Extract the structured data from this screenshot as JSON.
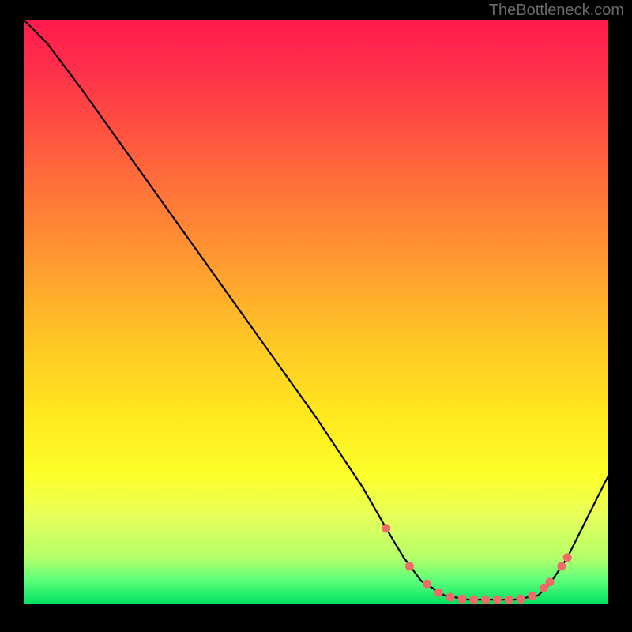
{
  "watermark": "TheBottleneck.com",
  "chart_data": {
    "type": "line",
    "title": "",
    "xlabel": "",
    "ylabel": "",
    "xlim": [
      0,
      100
    ],
    "ylim": [
      0,
      100
    ],
    "curve": {
      "x": [
        0,
        4,
        10,
        20,
        30,
        40,
        50,
        58,
        62,
        65,
        68,
        72,
        76,
        80,
        84,
        88,
        90,
        93,
        100
      ],
      "y": [
        100,
        96,
        88,
        74,
        60,
        46,
        32,
        20,
        13,
        8,
        4,
        1.5,
        0.8,
        0.8,
        0.8,
        1.5,
        3.5,
        8,
        22
      ]
    },
    "markers": {
      "x": [
        62,
        66,
        69,
        71,
        73,
        75,
        77,
        79,
        81,
        83,
        85,
        87,
        89,
        90,
        92,
        93
      ],
      "y": [
        13,
        6.5,
        3.5,
        2,
        1.2,
        0.9,
        0.8,
        0.8,
        0.8,
        0.8,
        0.9,
        1.4,
        2.8,
        3.8,
        6.5,
        8
      ]
    },
    "marker_color": "#f06a6a",
    "curve_color": "#000000"
  }
}
